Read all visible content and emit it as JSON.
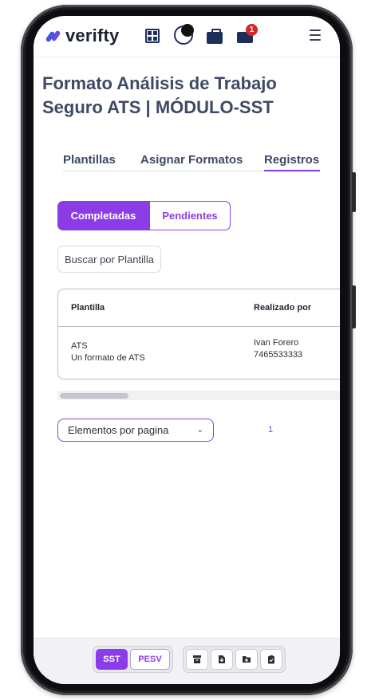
{
  "header": {
    "logo_text": "verifty",
    "notification_count": "1"
  },
  "page": {
    "title_line1": "Formato Análisis de Trabajo",
    "title_line2": "Seguro ATS | MÓDULO-SST"
  },
  "tabs": [
    {
      "label": "Plantillas",
      "active": false
    },
    {
      "label": "Asignar Formatos",
      "active": false
    },
    {
      "label": "Registros",
      "active": true
    }
  ],
  "segmented": {
    "completed_label": "Completadas",
    "pending_label": "Pendientes"
  },
  "search": {
    "placeholder": "Buscar por Plantilla"
  },
  "table": {
    "headers": [
      "Plantilla",
      "Realizado por"
    ],
    "rows": [
      {
        "template_name": "ATS",
        "template_desc": "Un formato de ATS",
        "user_name": "Ivan Forero",
        "user_id": "7465533333"
      }
    ]
  },
  "pagination": {
    "per_page_label": "Elementos por pagina",
    "current_page": "1"
  },
  "bottom_bar": {
    "module_sst": "SST",
    "module_pesv": "PESV",
    "icons": [
      "archive-icon",
      "download-icon",
      "folder-add-icon",
      "clipboard-check-icon"
    ]
  },
  "colors": {
    "accent": "#8b3ce6",
    "title": "#3e4a63",
    "badge": "#d62828"
  }
}
